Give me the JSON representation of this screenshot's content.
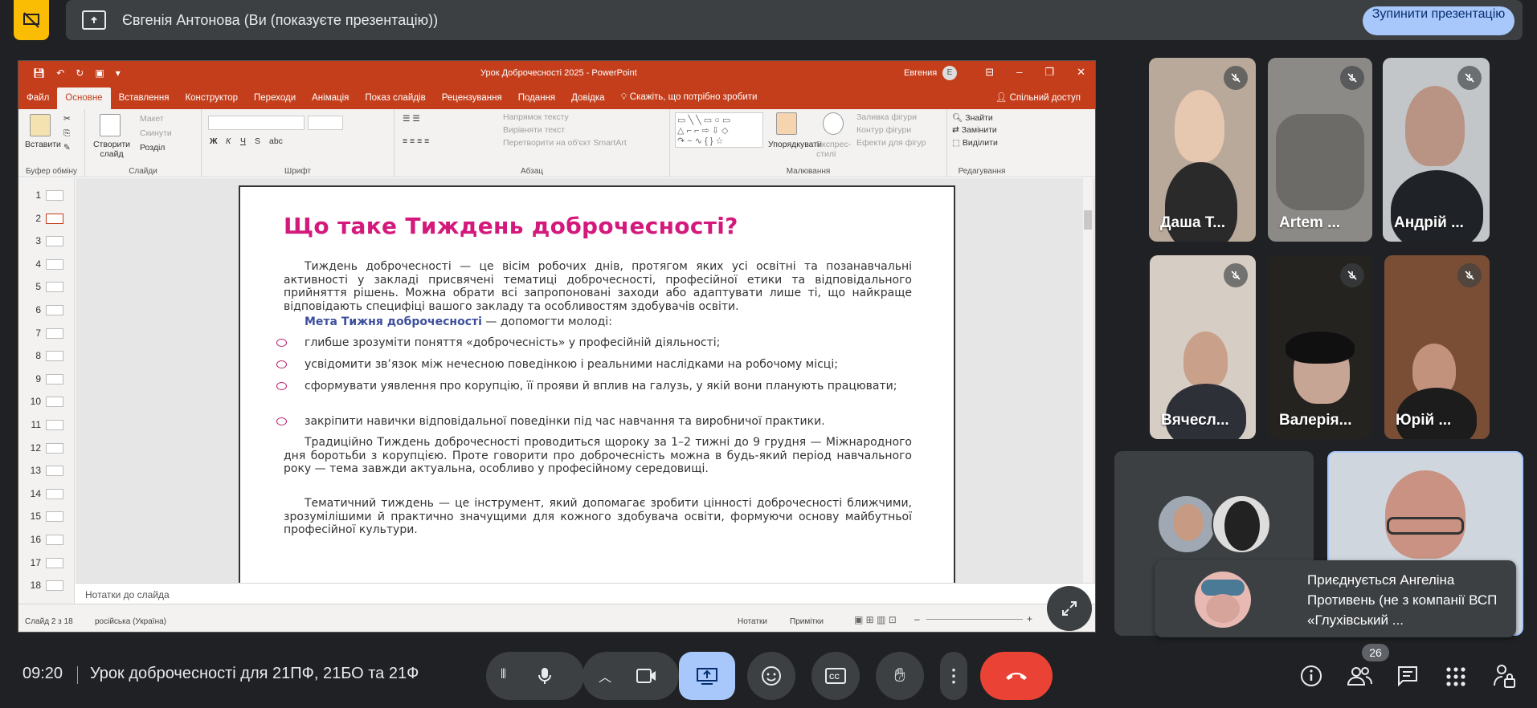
{
  "banner": {
    "presenter_text": "Євгенія Антонова (Ви (показуєте презентацію))",
    "stop_label": "Зупинити презентацію"
  },
  "ppt": {
    "doc_title": "Урок Доброчесності 2025  -  PowerPoint",
    "user_name": "Евгения",
    "user_initial": "Е",
    "tabs": [
      "Файл",
      "Основне",
      "Вставлення",
      "Конструктор",
      "Переходи",
      "Анімація",
      "Показ слайдів",
      "Рецензування",
      "Подання",
      "Довідка"
    ],
    "active_tab": "Основне",
    "tell_me": "Скажіть, що потрібно зробити",
    "share": "Спільний доступ",
    "ribbon": {
      "clipboard": {
        "label": "Буфер обміну",
        "paste": "Вставити"
      },
      "slides": {
        "label": "Слайди",
        "new_slide": "Створити слайд",
        "layout": "Макет",
        "reset": "Скинути",
        "section": "Розділ"
      },
      "font": {
        "label": "Шрифт"
      },
      "paragraph": {
        "label": "Абзац",
        "direction": "Напрямок тексту",
        "align": "Вирівняти текст",
        "smartart": "Перетворити на об'єкт SmartArt"
      },
      "drawing": {
        "label": "Малювання",
        "arrange": "Упорядкувати",
        "quick": "Експрес-стилі",
        "fill": "Заливка фігури",
        "outline": "Контур фігури",
        "effects": "Ефекти для фігур"
      },
      "editing": {
        "label": "Редагування",
        "find": "Знайти",
        "replace": "Замінити",
        "select": "Виділити"
      }
    },
    "thumbs": [
      "1",
      "2",
      "3",
      "4",
      "5",
      "6",
      "7",
      "8",
      "9",
      "10",
      "11",
      "12",
      "13",
      "14",
      "15",
      "16",
      "17",
      "18"
    ],
    "selected_thumb": "2",
    "slide": {
      "heading": "Що таке Тиждень доброчесності?",
      "p1": "Тиждень доброчесності — це вісім робочих днів, протягом яких усі освітні та позанавчальні активності у закладі присвячені тематиці доброчесності, професійної етики та відповідального прийняття рішень. Можна обрати всі запропоновані заходи або адаптувати лише ті, що найкраще відповідають специфіці вашого закладу та особливостям здобувачів освіти.",
      "goal_bold": "Мета Тижня доброчесності",
      "goal_rest": " — допомогти молоді:",
      "bullets": [
        "глибше зрозуміти поняття «доброчесність» у професійній діяльності;",
        "усвідомити зв’язок між нечесною поведінкою і реальними наслідками на робочому місці;",
        "сформувати уявлення про корупцію, її прояви й вплив на галузь, у якій вони планують працювати;",
        "закріпити навички відповідальної поведінки під час навчання та виробничої практики."
      ],
      "p2": "Традиційно Тиждень доброчесності проводиться щороку за 1–2 тижні до 9 грудня — Міжнародного дня боротьби з корупцією. Проте говорити про доброчесність можна в будь-який період навчального року — тема завжди актуальна, особливо у професійному середовищі.",
      "p3": "Тематичний тиждень — це інструмент, який допомагає зробити цінності доброчесності ближчими, зрозумілішими й практично значущими для кожного здобувача освіти, формуючи основу майбутньої професійної культури."
    },
    "notes_placeholder": "Нотатки до слайда",
    "status": {
      "slide_counter": "Слайд 2 з 18",
      "language": "російська (Україна)",
      "notes_btn": "Нотатки",
      "comments_btn": "Примітки"
    }
  },
  "participants": [
    {
      "name": "Даша Т...",
      "muted": true
    },
    {
      "name": "Artem ...",
      "muted": true
    },
    {
      "name": "Андрій ...",
      "muted": true
    },
    {
      "name": "Вячесл...",
      "muted": true
    },
    {
      "name": "Валерія...",
      "muted": true
    },
    {
      "name": "Юрій ...",
      "muted": true
    }
  ],
  "toast": {
    "message": "Приєднується Ангеліна Противень (не з компанії ВСП «Глухівський ..."
  },
  "bottom": {
    "time": "09:20",
    "meeting_title": "Урок доброчесності для 21ПФ, 21БО та 21Ф",
    "participant_count": "26"
  },
  "colors": {
    "meet_bg": "#202124",
    "tile_bg": "#3c4043",
    "accent_blue": "#a8c7fa",
    "end_call_red": "#ea4335",
    "ppt_orange": "#c43e1c",
    "heading_pink": "#d4197c"
  }
}
